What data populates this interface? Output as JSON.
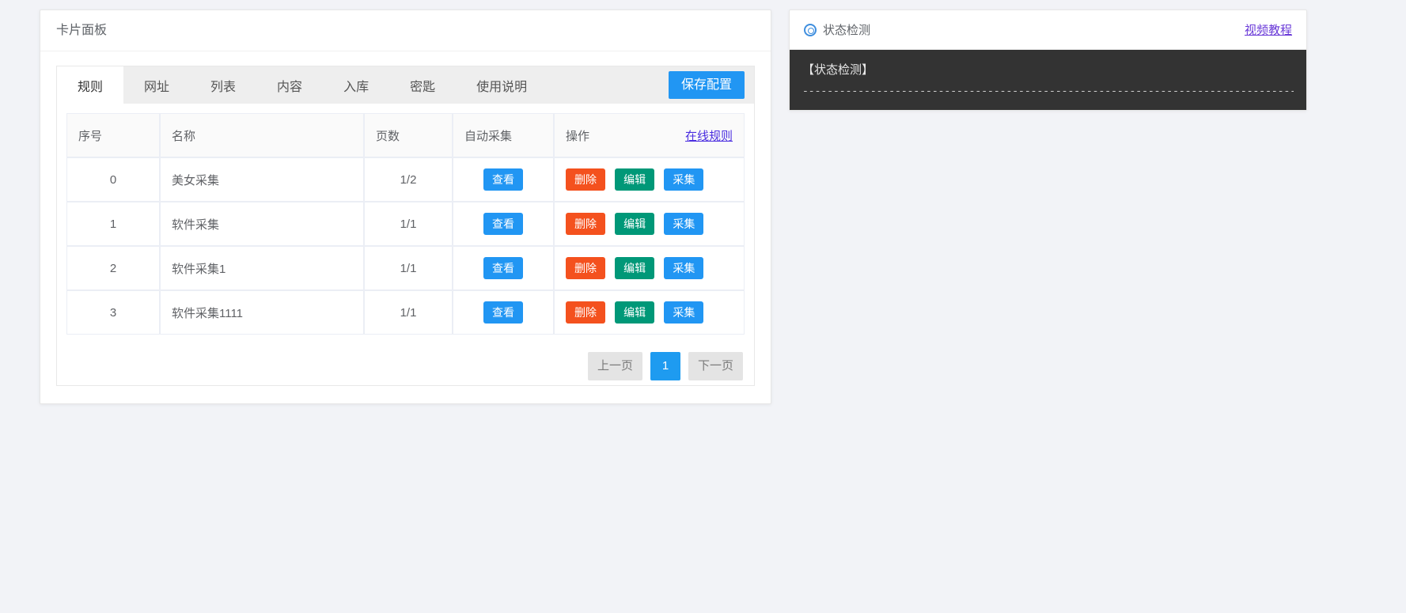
{
  "card": {
    "title": "卡片面板",
    "tabs": [
      {
        "label": "规则",
        "active": true
      },
      {
        "label": "网址",
        "active": false
      },
      {
        "label": "列表",
        "active": false
      },
      {
        "label": "内容",
        "active": false
      },
      {
        "label": "入库",
        "active": false
      },
      {
        "label": "密匙",
        "active": false
      },
      {
        "label": "使用说明",
        "active": false
      }
    ],
    "save_label": "保存配置",
    "table": {
      "headers": {
        "index": "序号",
        "name": "名称",
        "pages": "页数",
        "auto": "自动采集",
        "ops": "操作"
      },
      "online_rules_link": "在线规则",
      "rows": [
        {
          "index": "0",
          "name": "美女采集",
          "pages": "1/2",
          "view": "查看",
          "delete": "删除",
          "edit": "编辑",
          "collect": "采集"
        },
        {
          "index": "1",
          "name": "软件采集",
          "pages": "1/1",
          "view": "查看",
          "delete": "删除",
          "edit": "编辑",
          "collect": "采集"
        },
        {
          "index": "2",
          "name": "软件采集1",
          "pages": "1/1",
          "view": "查看",
          "delete": "删除",
          "edit": "编辑",
          "collect": "采集"
        },
        {
          "index": "3",
          "name": "软件采集1111",
          "pages": "1/1",
          "view": "查看",
          "delete": "删除",
          "edit": "编辑",
          "collect": "采集"
        }
      ]
    },
    "pagination": {
      "prev": "上一页",
      "current": "1",
      "next": "下一页"
    }
  },
  "panel": {
    "icon": "target-icon",
    "title": "状态检测",
    "tutorial_link": "视频教程",
    "console": {
      "heading": "【状态检测】",
      "separator": "--------------------------------------------------------------------------------"
    }
  },
  "colors": {
    "page_background": "#f2f3f7",
    "primary_blue": "#2196f3",
    "delete_orange": "#f4511e",
    "edit_green": "#009878",
    "link_purple": "#4b2ee0",
    "console_dark": "#333333"
  }
}
